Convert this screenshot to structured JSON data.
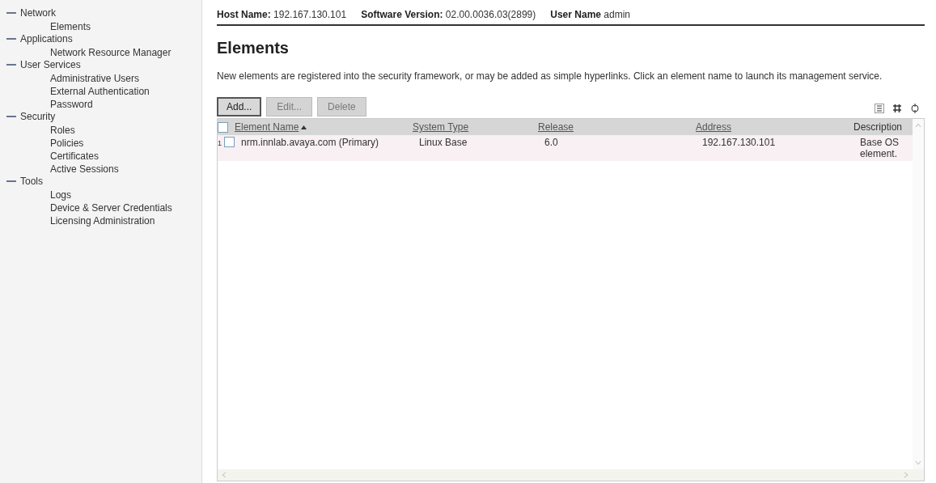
{
  "sidebar": {
    "items": [
      {
        "label": "Network",
        "expanded": true,
        "children": [
          {
            "label": "Elements"
          }
        ]
      },
      {
        "label": "Applications",
        "expanded": true,
        "children": [
          {
            "label": "Network Resource Manager"
          }
        ]
      },
      {
        "label": "User Services",
        "expanded": true,
        "children": [
          {
            "label": "Administrative Users"
          },
          {
            "label": "External Authentication"
          },
          {
            "label": "Password"
          }
        ]
      },
      {
        "label": "Security",
        "expanded": true,
        "children": [
          {
            "label": "Roles"
          },
          {
            "label": "Policies"
          },
          {
            "label": "Certificates"
          },
          {
            "label": "Active Sessions"
          }
        ]
      },
      {
        "label": "Tools",
        "expanded": true,
        "children": [
          {
            "label": "Logs"
          },
          {
            "label": "Device & Server Credentials"
          },
          {
            "label": "Licensing Administration"
          }
        ]
      }
    ]
  },
  "header": [
    {
      "label": "Host Name:",
      "value": "192.167.130.101"
    },
    {
      "label": "Software Version:",
      "value": "02.00.0036.03(2899)"
    },
    {
      "label": "User Name",
      "value": "admin"
    }
  ],
  "page": {
    "title": "Elements",
    "description": "New elements are registered into the security framework, or may be added as simple hyperlinks. Click an element name to launch its management service."
  },
  "buttons": [
    {
      "label": "Add...",
      "disabled": false
    },
    {
      "label": "Edit...",
      "disabled": true
    },
    {
      "label": "Delete",
      "disabled": true
    }
  ],
  "table": {
    "select_all_checked": false,
    "columns": [
      {
        "label": "Element Name",
        "link": true,
        "sorted": true
      },
      {
        "label": "System Type",
        "link": true,
        "sorted": false
      },
      {
        "label": "Release",
        "link": true,
        "sorted": false
      },
      {
        "label": "Address",
        "link": true,
        "sorted": false
      },
      {
        "label": "Description",
        "link": false,
        "sorted": false
      }
    ],
    "rows": [
      {
        "number": "1",
        "checked": false,
        "cells": [
          "nrm.innlab.avaya.com (Primary)",
          "Linux Base",
          "6.0",
          "192.167.130.101",
          "Base OS element."
        ]
      }
    ]
  }
}
